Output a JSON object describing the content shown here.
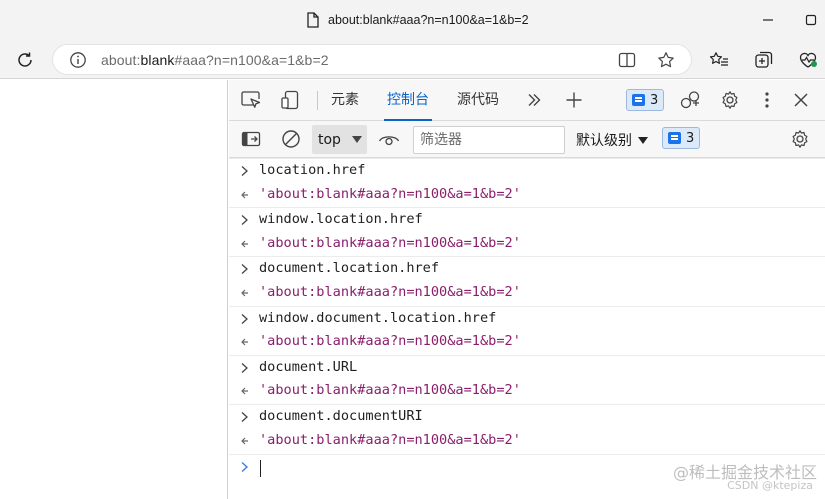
{
  "window": {
    "title": "about:blank#aaa?n=n100&a=1&b=2"
  },
  "address_bar": {
    "url_prefix": "about:",
    "url_host": "blank",
    "url_rest": "#aaa?n=n100&a=1&b=2"
  },
  "devtools": {
    "tabs": [
      {
        "label": "元素",
        "active": false
      },
      {
        "label": "控制台",
        "active": true
      },
      {
        "label": "源代码",
        "active": false
      }
    ],
    "issues_count": "3",
    "console": {
      "context": "top",
      "filter_placeholder": "筛选器",
      "levels_label": "默认级别",
      "messages_count": "3",
      "entries": [
        {
          "kind": "input",
          "text": "location.href"
        },
        {
          "kind": "output",
          "text": "'about:blank#aaa?n=n100&a=1&b=2'"
        },
        {
          "kind": "input",
          "text": "window.location.href"
        },
        {
          "kind": "output",
          "text": "'about:blank#aaa?n=n100&a=1&b=2'"
        },
        {
          "kind": "input",
          "text": "document.location.href"
        },
        {
          "kind": "output",
          "text": "'about:blank#aaa?n=n100&a=1&b=2'"
        },
        {
          "kind": "input",
          "text": "window.document.location.href"
        },
        {
          "kind": "output",
          "text": "'about:blank#aaa?n=n100&a=1&b=2'"
        },
        {
          "kind": "input",
          "text": "document.URL"
        },
        {
          "kind": "output",
          "text": "'about:blank#aaa?n=n100&a=1&b=2'"
        },
        {
          "kind": "input",
          "text": "document.documentURI"
        },
        {
          "kind": "output",
          "text": "'about:blank#aaa?n=n100&a=1&b=2'"
        }
      ]
    }
  },
  "watermark": {
    "main": "@稀土掘金技术社区",
    "sub": "CSDN @ktepiza"
  },
  "colors": {
    "accent": "#0a64c8",
    "string_output": "#8a1e6b",
    "badge_bg": "#dce9f8"
  }
}
